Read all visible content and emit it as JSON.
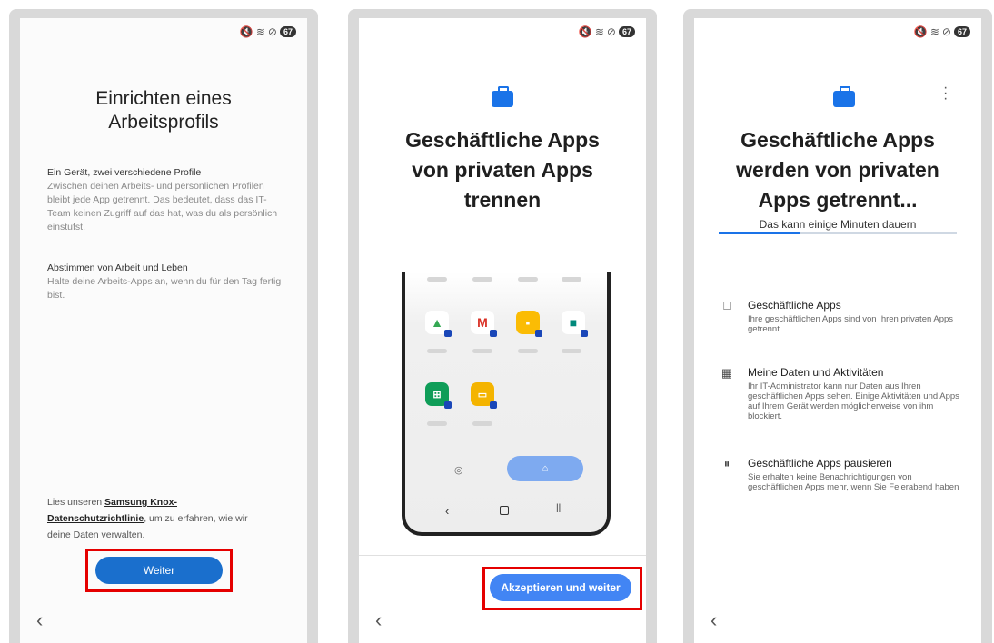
{
  "status": {
    "battery": "67"
  },
  "screen1": {
    "title_line1": "Einrichten eines",
    "title_line2": "Arbeitsprofils",
    "section1_heading": "Ein Gerät, zwei verschiedene Profile",
    "section1_body": "Zwischen deinen Arbeits- und persönlichen Profilen bleibt jede App getrennt. Das bedeutet, dass das IT-Team keinen Zugriff auf das hat, was du als persönlich einstufst.",
    "section2_heading": "Abstimmen von Arbeit und Leben",
    "section2_body": "Halte deine Arbeits-Apps an, wenn du für den Tag fertig bist.",
    "privacy_prefix": "Lies unseren ",
    "privacy_link": "Samsung Knox-Datenschutzrichtlinie",
    "privacy_suffix": ", um zu erfahren, wie wir deine Daten verwalten.",
    "next_button": "Weiter",
    "back_icon": "‹"
  },
  "screen2": {
    "title_line1": "Geschäftliche Apps",
    "title_line2": "von privaten Apps",
    "title_line3": "trennen",
    "apps": [
      "Google Drive",
      "Gmail",
      "Google Keep",
      "Google Meet",
      "Google Sheets",
      "Google Slides"
    ],
    "accept_button": "Akzeptieren und weiter",
    "back_icon": "‹"
  },
  "screen3": {
    "title_line1": "Geschäftliche Apps",
    "title_line2": "werden von privaten",
    "title_line3": "Apps getrennt...",
    "subtitle": "Das kann einige Minuten dauern",
    "items": [
      {
        "icon": "briefcase-icon",
        "title": "Geschäftliche Apps",
        "desc": "Ihre geschäftlichen Apps sind von Ihren privaten Apps getrennt"
      },
      {
        "icon": "building-icon",
        "title": "Meine Daten und Aktivitäten",
        "desc": "Ihr IT-Administrator kann nur Daten aus Ihren geschäftlichen Apps sehen. Einige Aktivitäten und Apps auf Ihrem Gerät werden möglicherweise von ihm blockiert."
      },
      {
        "icon": "pause-icon",
        "title": "Geschäftliche Apps pausieren",
        "desc": "Sie erhalten keine Benachrichtigungen von geschäftlichen Apps mehr, wenn Sie Feierabend haben"
      }
    ],
    "back_icon": "‹"
  },
  "colors": {
    "accent": "#1a73e8",
    "highlight": "#e50000"
  }
}
